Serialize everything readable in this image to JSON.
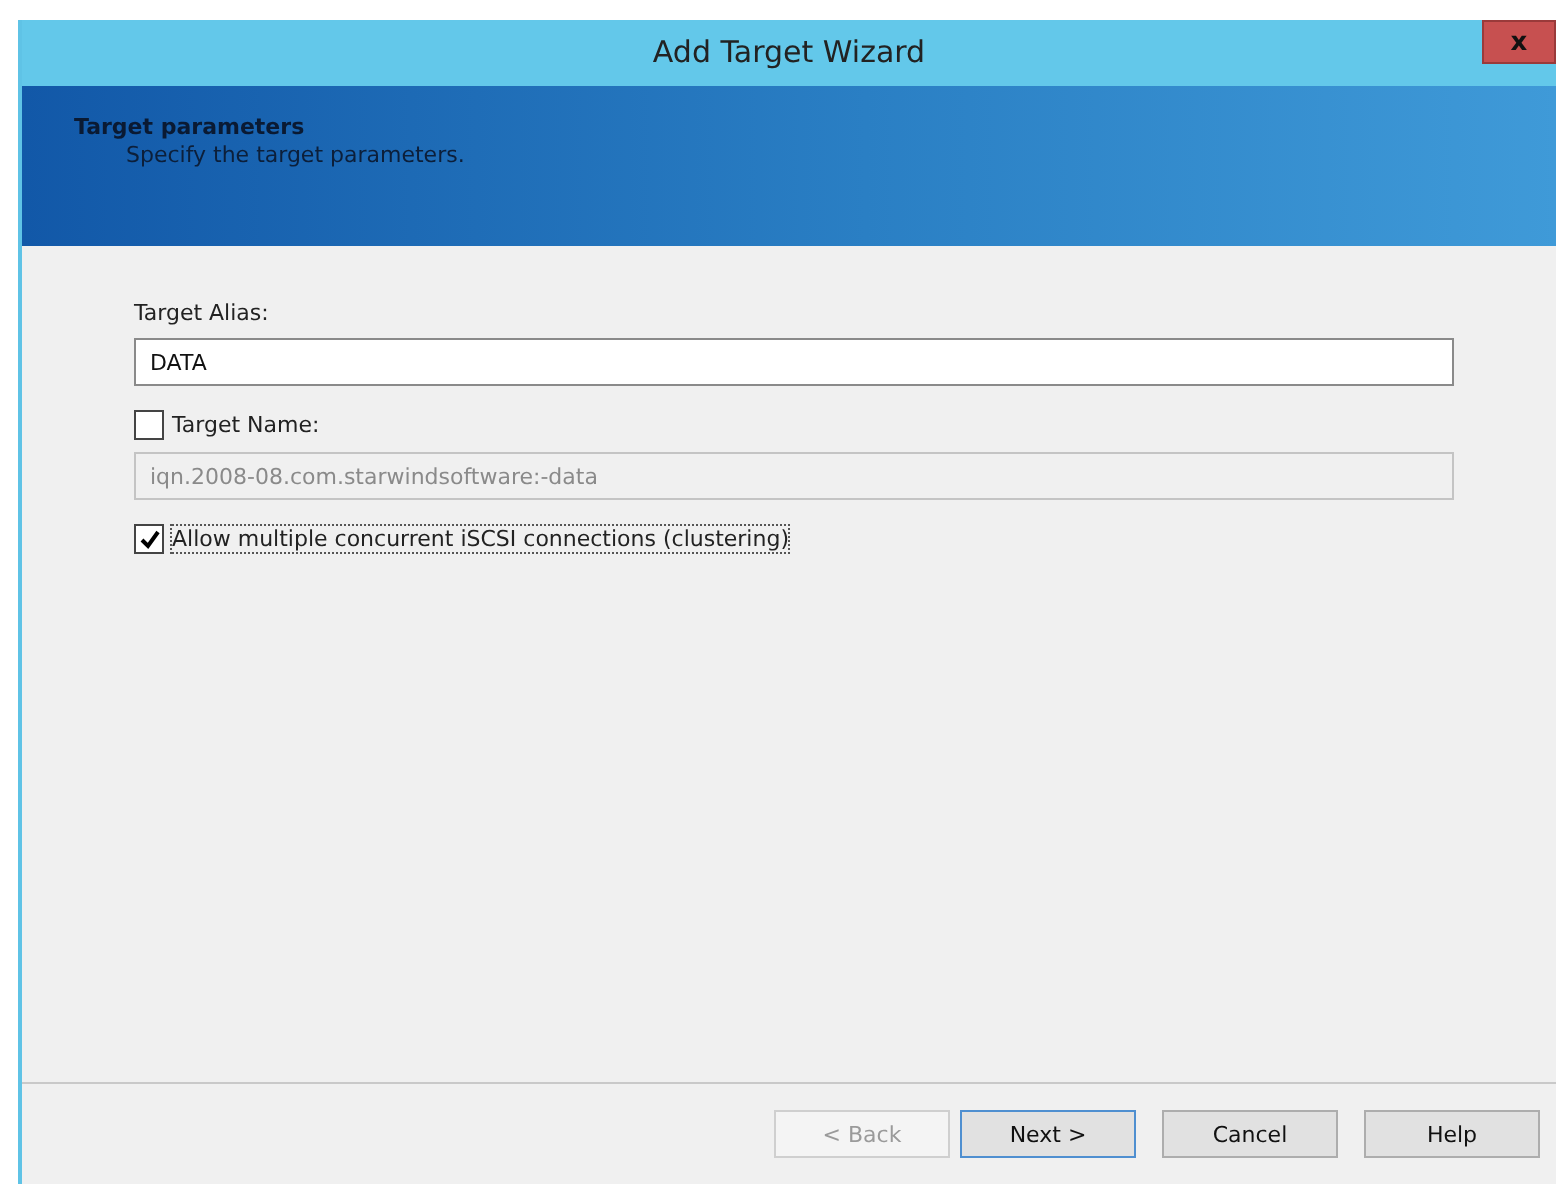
{
  "window": {
    "title": "Add Target Wizard",
    "close_glyph": "x"
  },
  "header": {
    "title": "Target parameters",
    "subtitle": "Specify the target parameters."
  },
  "alias": {
    "label": "Target Alias:",
    "value": "DATA"
  },
  "target_name": {
    "label": "Target Name:",
    "checked": false,
    "value": "iqn.2008-08.com.starwindsoftware:-data",
    "disabled": true
  },
  "clustering": {
    "label": "Allow multiple concurrent iSCSI connections (clustering)",
    "checked": true
  },
  "buttons": [
    {
      "label": "< Back",
      "disabled": true,
      "default": false
    },
    {
      "label": "Next >",
      "disabled": false,
      "default": true
    },
    {
      "label": "Cancel",
      "disabled": false,
      "default": false
    },
    {
      "label": "Help",
      "disabled": false,
      "default": false
    }
  ]
}
